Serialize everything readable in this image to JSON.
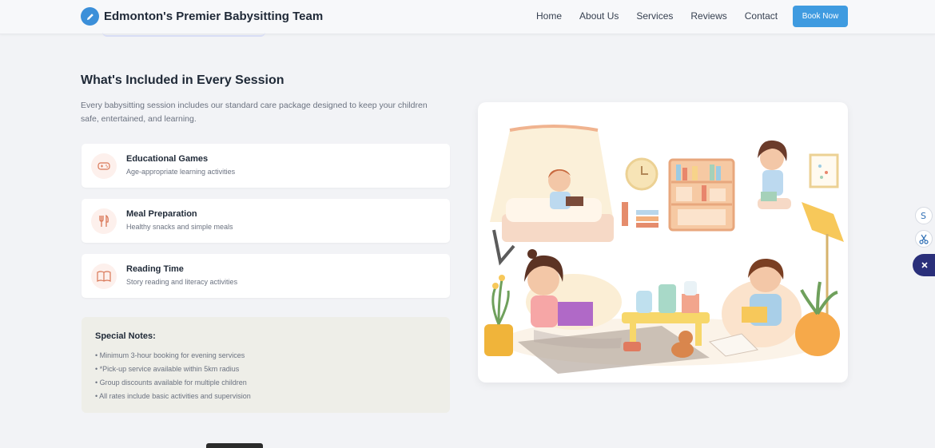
{
  "header": {
    "brand_title": "Edmonton's Premier Babysitting Team",
    "nav": [
      "Home",
      "About Us",
      "Services",
      "Reviews",
      "Contact"
    ],
    "cta_label": "Book Now"
  },
  "section": {
    "title": "What's Included in Every Session",
    "description": "Every babysitting session includes our standard care package designed to keep your children safe, entertained, and learning."
  },
  "features": [
    {
      "title": "Educational Games",
      "subtitle": "Age-appropriate learning activities",
      "icon": "gamepad-icon"
    },
    {
      "title": "Meal Preparation",
      "subtitle": "Healthy snacks and simple meals",
      "icon": "utensils-icon"
    },
    {
      "title": "Reading Time",
      "subtitle": "Story reading and literacy activities",
      "icon": "book-icon"
    }
  ],
  "notes": {
    "title": "Special Notes:",
    "items": [
      "Minimum 3-hour booking for evening services",
      "*Pick-up service available within 5km radius",
      "Group discounts available for multiple children",
      "All rates include basic activities and supervision"
    ]
  },
  "colors": {
    "accent": "#3f9be0",
    "icon_bg": "#fdf0ec",
    "icon_stroke": "#d97757",
    "notes_bg": "#eeeee8"
  }
}
